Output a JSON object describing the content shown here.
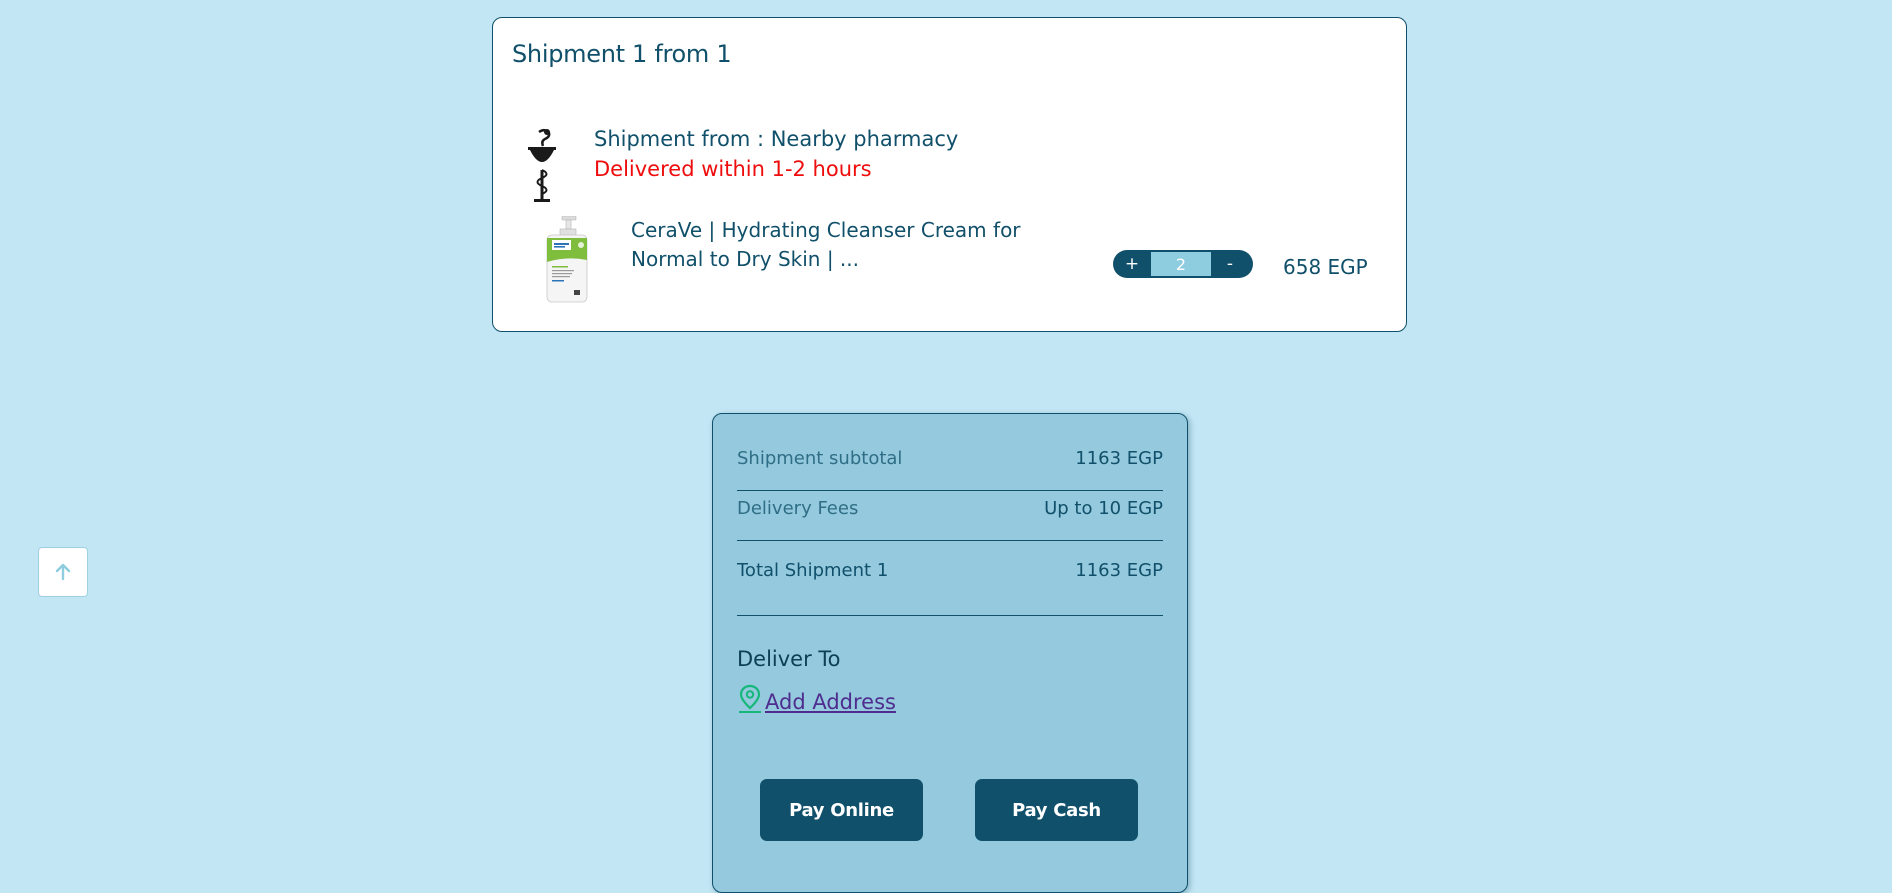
{
  "shipment": {
    "title": "Shipment 1 from 1",
    "from_label": "Shipment from : Nearby pharmacy",
    "delivery_time": "Delivered within 1-2 hours",
    "item": {
      "name": "CeraVe | Hydrating Cleanser Cream for Normal to Dry Skin | ...",
      "quantity": "2",
      "plus_label": "+",
      "minus_label": "-",
      "price": "658 EGP"
    }
  },
  "summary": {
    "subtotal_label": "Shipment subtotal",
    "subtotal_value": "1163 EGP",
    "delivery_label": "Delivery Fees",
    "delivery_value": "Up to 10 EGP",
    "total_label": "Total Shipment 1",
    "total_value": "1163 EGP",
    "deliver_to_label": "Deliver To",
    "add_address_label": "Add Address",
    "pay_online_label": "Pay Online",
    "pay_cash_label": "Pay Cash"
  },
  "icons": {
    "pharmacy": "pharmacy-snake-bowl-icon",
    "location": "location-pin-icon",
    "scroll_top": "arrow-up-icon"
  },
  "colors": {
    "background": "#c2e6f4",
    "primary": "#11506a",
    "alert": "#ee0c0c",
    "summary_bg": "#94c9de",
    "location_pin": "#16b87a"
  }
}
